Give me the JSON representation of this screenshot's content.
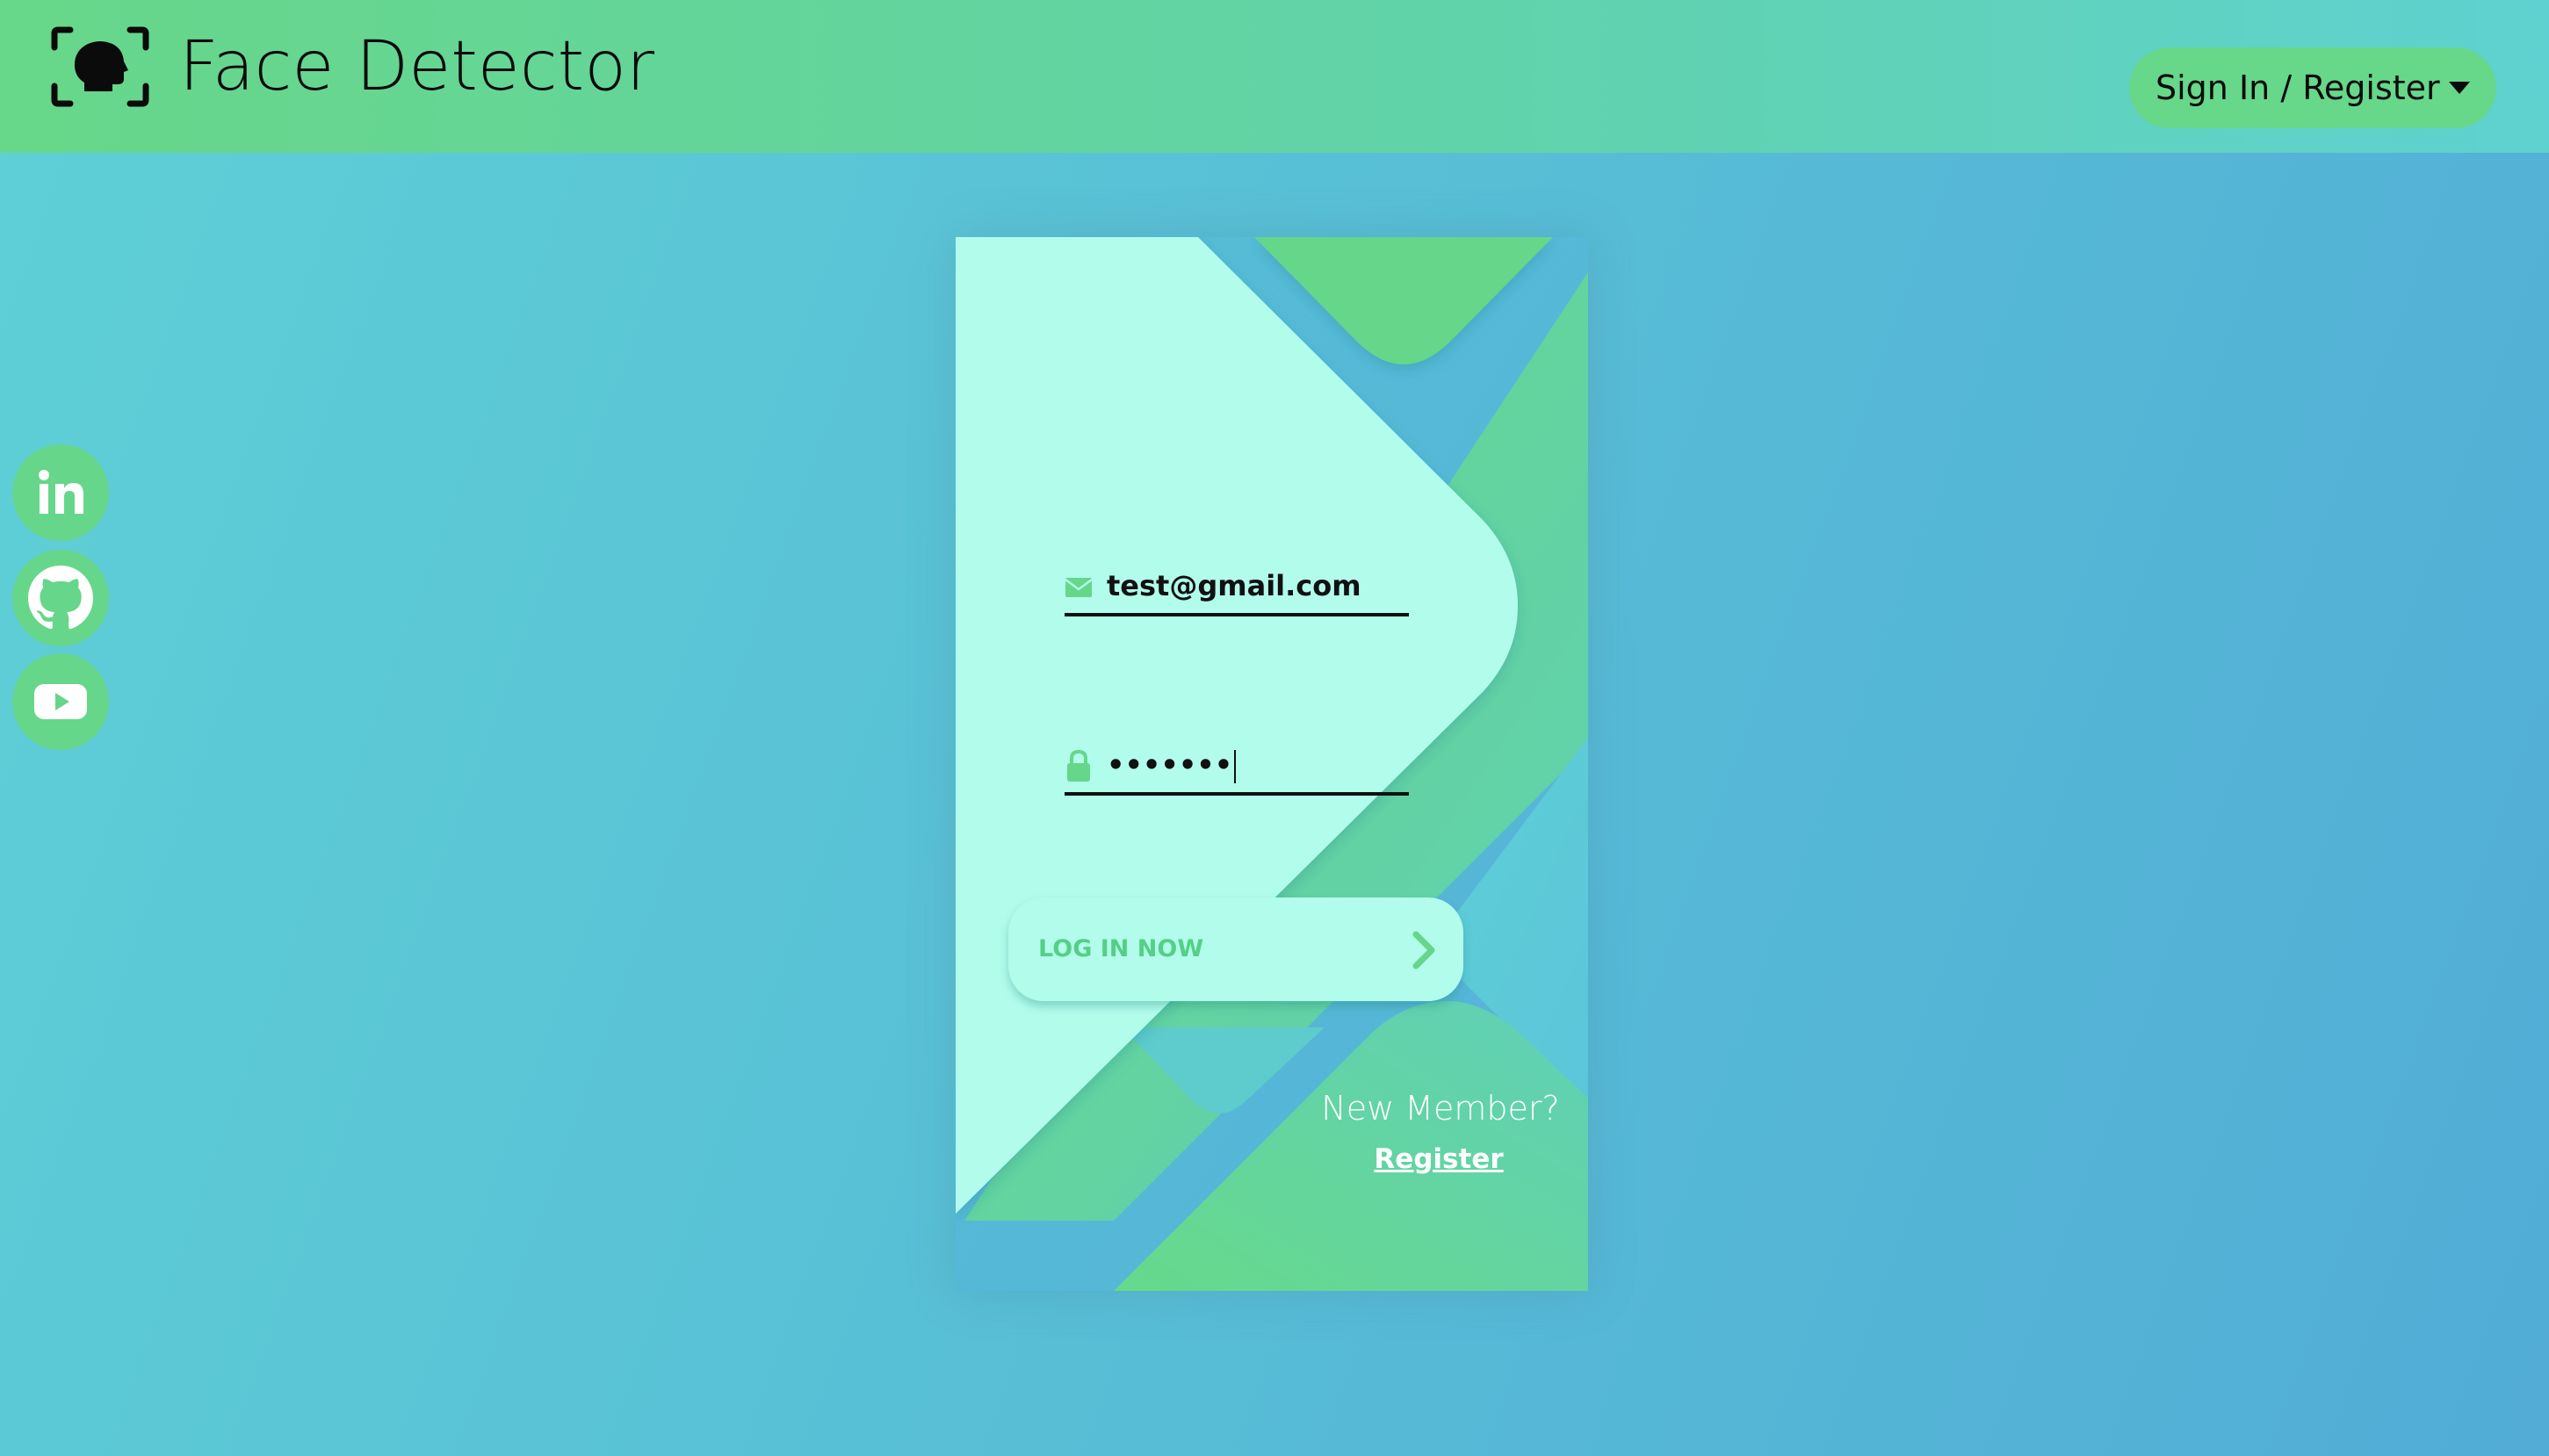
{
  "header": {
    "app_title": "Face Detector",
    "logo_icon": "face-scan-icon",
    "auth_menu_label": "Sign In / Register",
    "auth_menu_icon": "caret-down-icon"
  },
  "social_links": [
    {
      "name": "LinkedIn",
      "icon": "linkedin-icon"
    },
    {
      "name": "GitHub",
      "icon": "github-icon"
    },
    {
      "name": "YouTube",
      "icon": "youtube-icon"
    }
  ],
  "login_form": {
    "email": {
      "icon": "envelope-icon",
      "value": "test@gmail.com"
    },
    "password": {
      "icon": "lock-icon",
      "value": "•••••••"
    },
    "submit_label": "LOG IN NOW",
    "submit_icon": "chevron-right-icon",
    "new_member_text": "New Member?",
    "register_link": "Register"
  },
  "colors": {
    "background_start": "#5fd0d6",
    "background_end": "#52acd6",
    "header_start": "#67d789",
    "header_end": "#5fd1d0",
    "accent_green": "#66d68a",
    "card_mint": "#b2fcec",
    "text_dark": "#0b0b0b"
  }
}
